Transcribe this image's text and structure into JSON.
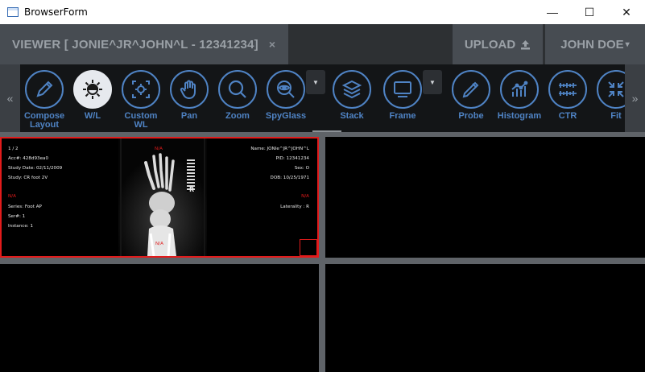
{
  "window": {
    "title": "BrowserForm",
    "minimize": "—",
    "maximize": "☐",
    "close": "✕"
  },
  "header": {
    "viewer_tab": "VIEWER [ JONIE^JR^JOHN^L - 12341234]",
    "close_glyph": "×",
    "upload_label": "UPLOAD",
    "user_label": "JOHN DOE",
    "user_caret": "▾"
  },
  "toolbar": {
    "scroll_left": "«",
    "scroll_right": "»",
    "dropdown_glyph": "▼",
    "tools": [
      {
        "label": "Compose\nLayout",
        "icon": "pencil-icon",
        "active": false
      },
      {
        "label": "W/L",
        "icon": "brightness-icon",
        "active": true
      },
      {
        "label": "Custom\nWL",
        "icon": "custom-wl-icon",
        "active": false
      },
      {
        "label": "Pan",
        "icon": "hand-icon",
        "active": false
      },
      {
        "label": "Zoom",
        "icon": "zoom-icon",
        "active": false
      },
      {
        "label": "SpyGlass",
        "icon": "spyglass-icon",
        "active": false
      },
      {
        "label": "Stack",
        "icon": "layers-icon",
        "active": false
      },
      {
        "label": "Frame",
        "icon": "frame-icon",
        "active": false
      },
      {
        "label": "Probe",
        "icon": "probe-icon",
        "active": false
      },
      {
        "label": "Histogram",
        "icon": "histogram-icon",
        "active": false
      },
      {
        "label": "CTR",
        "icon": "ruler-icon",
        "active": false
      },
      {
        "label": "Fit",
        "icon": "fit-icon",
        "active": false
      }
    ]
  },
  "pane1": {
    "frame": "1 / 2",
    "acc": "Acc#: 428d93ea0",
    "study_date": "Study Date: 02/11/2009",
    "study": "Study: CR foot 2V",
    "na_left": "N/A",
    "series": "Series: Foot AP",
    "ser": "Ser#: 1",
    "instance": "Instance: 1",
    "na_top": "N/A",
    "na_bottom": "N/A",
    "name": "Name: JONIe^JR^JOHN^L",
    "pid": "PID: 12341234",
    "sex": "Sex: O",
    "dob": "DOB: 10/25/1971",
    "na_right": "N/A",
    "laterality": "Laterality : R",
    "marker_r": "R"
  },
  "colors": {
    "accent": "#4f83c4",
    "active_border": "#e21b1b",
    "toolbar_bg": "#131517",
    "header_bg": "#2d3033",
    "tab_bg": "#474c52"
  }
}
